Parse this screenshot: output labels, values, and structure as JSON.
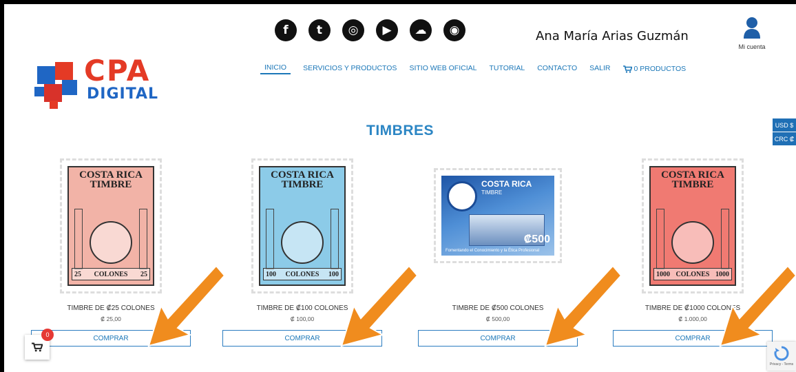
{
  "header": {
    "social_icons": [
      {
        "name": "facebook-icon",
        "glyph": "f"
      },
      {
        "name": "twitter-icon",
        "glyph": "t"
      },
      {
        "name": "instagram-icon",
        "glyph": "◎"
      },
      {
        "name": "youtube-icon",
        "glyph": "▶"
      },
      {
        "name": "soundcloud-icon",
        "glyph": "☁"
      },
      {
        "name": "podcast-icon",
        "glyph": "◉"
      }
    ],
    "username": "Ana María Arias Guzmán",
    "account_label": "Mi cuenta"
  },
  "logo": {
    "cpa": "CPA",
    "digital": "DIGITAL"
  },
  "nav": {
    "items": [
      "INICIO",
      "SERVICIOS Y PRODUCTOS",
      "SITIO WEB OFICIAL",
      "TUTORIAL",
      "CONTACTO",
      "SALIR"
    ],
    "cart_label": "0 PRODUCTOS"
  },
  "section_title": "TIMBRES",
  "currency": {
    "usd": "USD $",
    "crc": "CRC ₡"
  },
  "products": [
    {
      "name": "TIMBRE DE ₡25 COLONES",
      "price": "₡ 25,00",
      "buy": "COMPRAR",
      "stamp_head": "COSTA RICA TIMBRE",
      "stamp_value": "25",
      "stamp_unit": "COLONES",
      "color": "#f2b3a7"
    },
    {
      "name": "TIMBRE DE ₡100 COLONES",
      "price": "₡ 100,00",
      "buy": "COMPRAR",
      "stamp_head": "COSTA RICA TIMBRE",
      "stamp_value": "100",
      "stamp_unit": "COLONES",
      "color": "#8ccbe8"
    },
    {
      "name": "TIMBRE DE ₡500 COLONES",
      "price": "₡ 500,00",
      "buy": "COMPRAR",
      "stamp_head": "COSTA RICA",
      "stamp_sub": "TIMBRE",
      "stamp_value": "₡500",
      "stamp_slogan": "Fomentando el Conocimiento y la Ética Profesional"
    },
    {
      "name": "TIMBRE DE ₡1000 COLONES",
      "price": "₡ 1.000,00",
      "buy": "COMPRAR",
      "stamp_head": "COSTA RICA TIMBRE",
      "stamp_value": "1000",
      "stamp_unit": "COLONES",
      "color": "#f07a72"
    }
  ],
  "float_cart": {
    "badge": "0"
  },
  "recaptcha": {
    "label": "Privacy - Terms"
  },
  "colors": {
    "accent": "#1b77b8",
    "arrow": "#f08c1e",
    "danger": "#e53935"
  }
}
